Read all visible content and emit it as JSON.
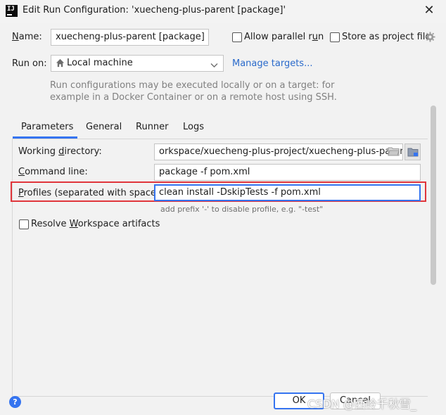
{
  "window": {
    "title": "Edit Run Configuration: 'xuecheng-plus-parent [package]'",
    "app_icon_text": "IJ",
    "close_glyph": "✕"
  },
  "name_row": {
    "label_prefix": "N",
    "label_rest": "ame:",
    "value": "xuecheng-plus-parent [package]",
    "allow_parallel_label": "Allow parallel r",
    "allow_parallel_label_u": "u",
    "allow_parallel_label_end": "n",
    "allow_parallel_checked": false,
    "store_label": "Store as project file",
    "store_checked": false
  },
  "run_on": {
    "label": "Run on:",
    "value": "Local machine",
    "manage_link": "Manage targets...",
    "hint_line1": "Run configurations may be executed locally or on a target: for",
    "hint_line2": "example in a Docker Container or on a remote host using SSH."
  },
  "tabs": [
    {
      "label": "Parameters",
      "active": true
    },
    {
      "label": "General",
      "active": false
    },
    {
      "label": "Runner",
      "active": false
    },
    {
      "label": "Logs",
      "active": false
    }
  ],
  "params": {
    "working_dir_label_pre": "Working ",
    "working_dir_label_u": "d",
    "working_dir_label_post": "irectory:",
    "working_dir_value": "orkspace/xuecheng-plus-project/xuecheng-plus-parent",
    "command_line_label_u": "C",
    "command_line_label_post": "ommand line:",
    "command_line_value": "package -f pom.xml",
    "profiles_label_u": "P",
    "profiles_label_post": "rofiles (separated with space):",
    "profiles_value": "clean install -DskipTests -f pom.xml",
    "profiles_hint": "add prefix '-' to disable profile, e.g. \"-test\"",
    "resolve_label_pre": "Resolve ",
    "resolve_label_u": "W",
    "resolve_label_post": "orkspace artifacts",
    "resolve_checked": false
  },
  "footer": {
    "ok_label": "OK",
    "cancel_label": "Cancel",
    "help_glyph": "?",
    "watermark": "CSDN @西岭千秋雪_"
  },
  "colors": {
    "accent": "#3574f0",
    "highlight_box": "#e0353b",
    "link": "#2a6acb"
  }
}
